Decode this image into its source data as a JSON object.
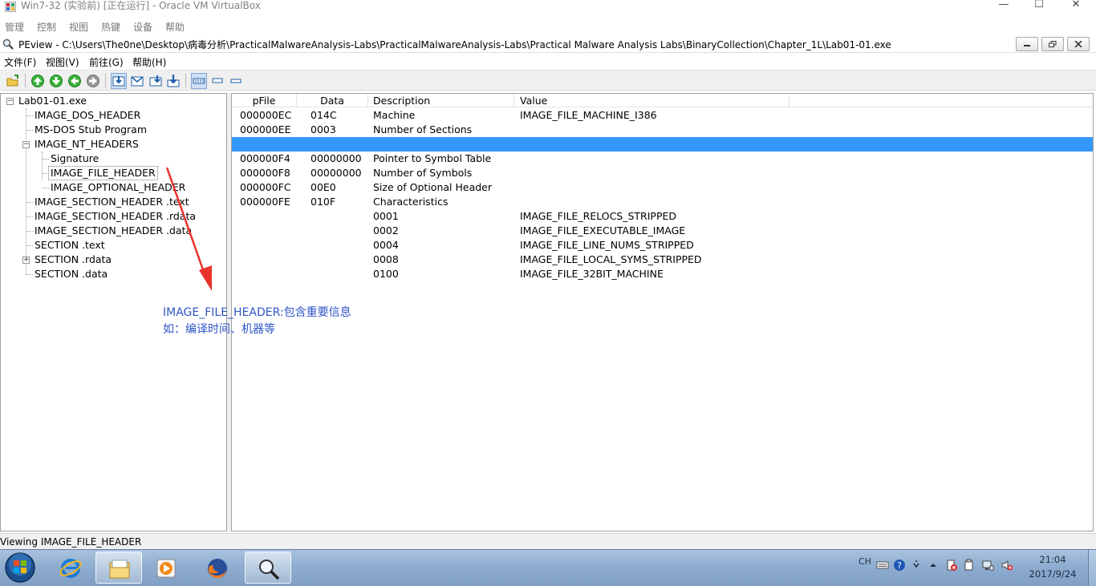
{
  "vbox": {
    "title": "Win7-32 (实验前) [正在运行] - Oracle VM VirtualBox",
    "menu": [
      "管理",
      "控制",
      "视图",
      "热键",
      "设备",
      "帮助"
    ]
  },
  "peview": {
    "title": "PEview - C:\\Users\\The0ne\\Desktop\\病毒分析\\PracticalMalwareAnalysis-Labs\\PracticalMalwareAnalysis-Labs\\Practical Malware Analysis Labs\\BinaryCollection\\Chapter_1L\\Lab01-01.exe",
    "menu": [
      "文件(F)",
      "视图(V)",
      "前往(G)",
      "帮助(H)"
    ]
  },
  "tree": {
    "root": "Lab01-01.exe",
    "items": [
      "IMAGE_DOS_HEADER",
      "MS-DOS Stub Program",
      "IMAGE_NT_HEADERS",
      "Signature",
      "IMAGE_FILE_HEADER",
      "IMAGE_OPTIONAL_HEADER",
      "IMAGE_SECTION_HEADER .text",
      "IMAGE_SECTION_HEADER .rdata",
      "IMAGE_SECTION_HEADER .data",
      "SECTION .text",
      "SECTION .rdata",
      "SECTION .data"
    ],
    "selected": "IMAGE_FILE_HEADER"
  },
  "grid": {
    "columns": [
      "pFile",
      "Data",
      "Description",
      "Value"
    ],
    "rows": [
      [
        "000000EC",
        "014C",
        "Machine",
        "IMAGE_FILE_MACHINE_I386"
      ],
      [
        "000000EE",
        "0003",
        "Number of Sections",
        ""
      ],
      [
        "",
        "",
        "",
        ""
      ],
      [
        "000000F4",
        "00000000",
        "Pointer to Symbol Table",
        ""
      ],
      [
        "000000F8",
        "00000000",
        "Number of Symbols",
        ""
      ],
      [
        "000000FC",
        "00E0",
        "Size of Optional Header",
        ""
      ],
      [
        "000000FE",
        "010F",
        "Characteristics",
        ""
      ],
      [
        "",
        "",
        "0001",
        "IMAGE_FILE_RELOCS_STRIPPED"
      ],
      [
        "",
        "",
        "0002",
        "IMAGE_FILE_EXECUTABLE_IMAGE"
      ],
      [
        "",
        "",
        "0004",
        "IMAGE_FILE_LINE_NUMS_STRIPPED"
      ],
      [
        "",
        "",
        "0008",
        "IMAGE_FILE_LOCAL_SYMS_STRIPPED"
      ],
      [
        "",
        "",
        "0100",
        "IMAGE_FILE_32BIT_MACHINE"
      ]
    ],
    "highlight_row": 3
  },
  "annotation": {
    "line1": "IMAGE_FILE_HEADER:包含重要信息",
    "line2": "如：编译时间、机器等",
    "color": "#2f55c7"
  },
  "status": {
    "text": "Viewing IMAGE_FILE_HEADER"
  },
  "taskbar": {
    "apps": [
      "start-orb",
      "internet-explorer-icon",
      "file-explorer-icon",
      "media-player-icon",
      "firefox-icon",
      "peview-magnifier-icon"
    ],
    "active_app": "peview-magnifier-icon",
    "tray": {
      "lang": "CH",
      "time": "21:04",
      "date": "2017/9/24"
    }
  },
  "colors": {
    "selection": "#3399ff",
    "taskbar": "#8fadd0"
  }
}
